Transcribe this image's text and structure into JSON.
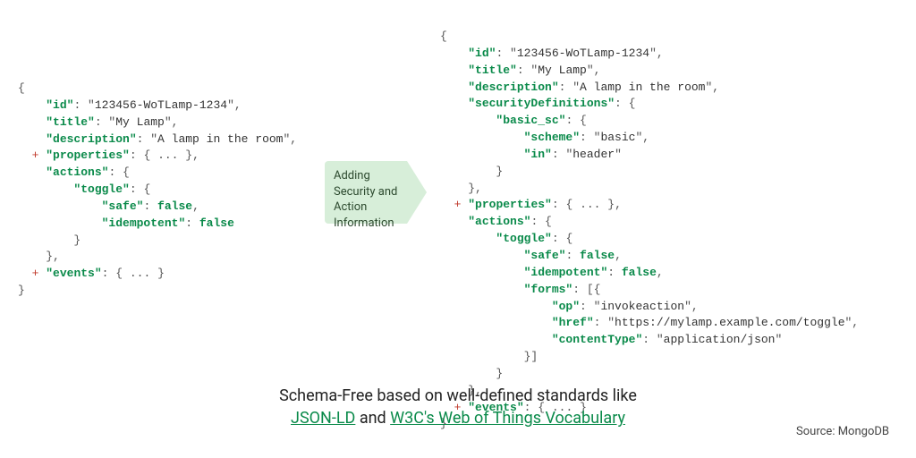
{
  "left_json": {
    "id": "123456-WoTLamp-1234",
    "title": "My Lamp",
    "description": "A lamp in the room",
    "actions": {
      "toggle": {
        "safe": false,
        "idempotent": false
      }
    }
  },
  "right_json": {
    "id": "123456-WoTLamp-1234",
    "title": "My Lamp",
    "description": "A lamp in the room",
    "securityDefinitions": {
      "basic_sc": {
        "scheme": "basic",
        "in": "header"
      }
    },
    "actions": {
      "toggle": {
        "safe": false,
        "idempotent": false,
        "forms": [
          {
            "op": "invokeaction",
            "href": "https://mylamp.example.com/toggle",
            "contentType": "application/json"
          }
        ]
      }
    }
  },
  "arrow_label": "Adding Security and Action Information",
  "caption_line1": "Schema-Free based on well-defined standards like",
  "caption_link1": "JSON-LD",
  "caption_join": " and ",
  "caption_link2": "W3C's Web of Things Vocabulary",
  "source": "Source: MongoDB",
  "ellipsis": "{ ... }"
}
